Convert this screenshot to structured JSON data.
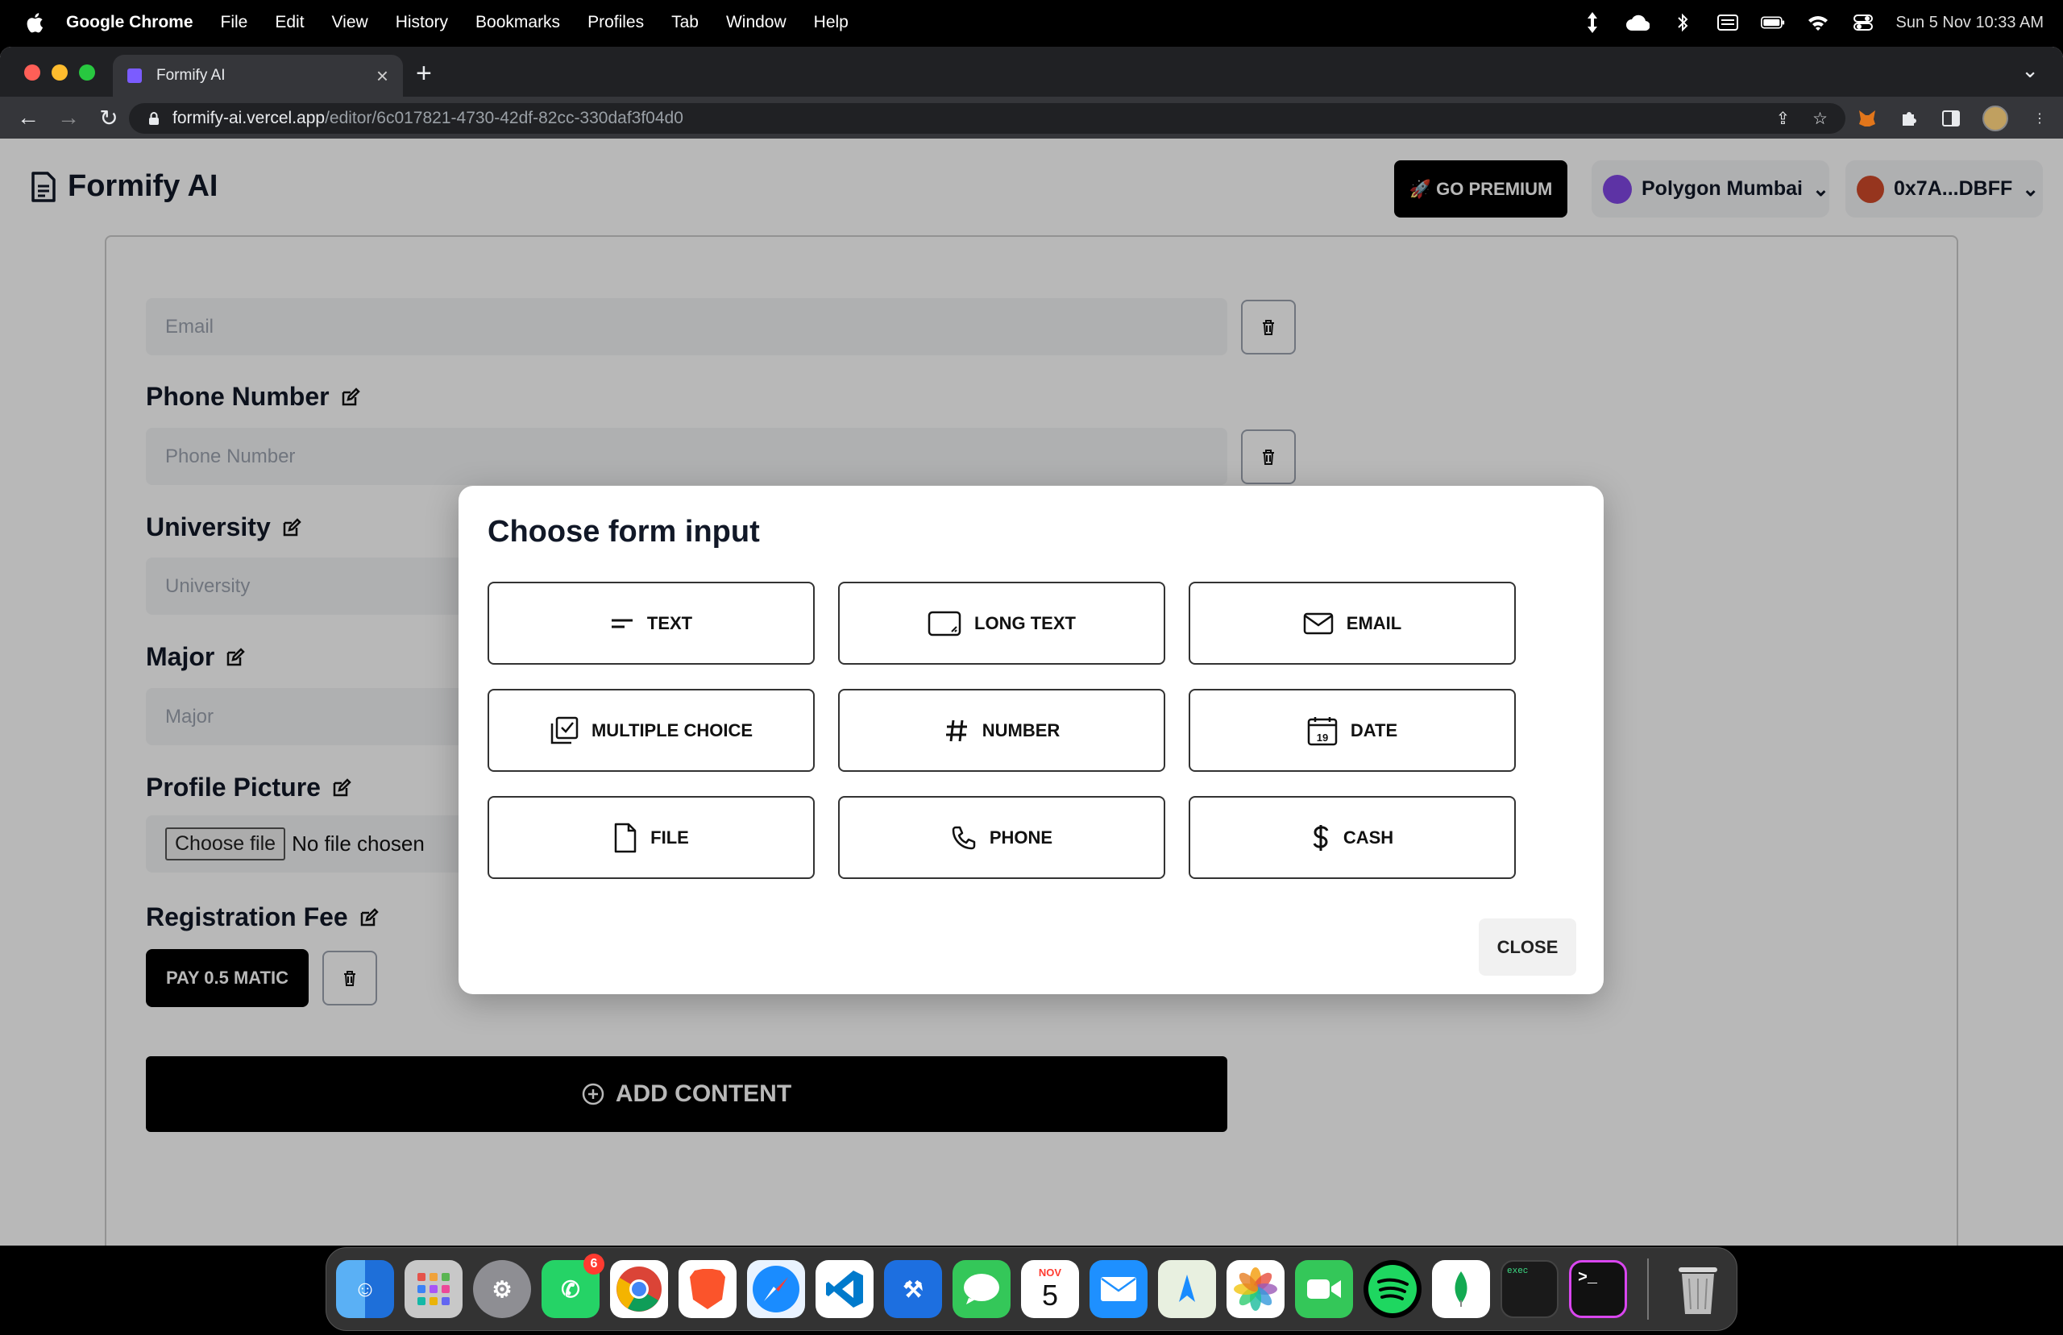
{
  "menubar": {
    "app": "Google Chrome",
    "items": [
      "File",
      "Edit",
      "View",
      "History",
      "Bookmarks",
      "Profiles",
      "Tab",
      "Window",
      "Help"
    ],
    "clock": "Sun 5 Nov  10:33 AM"
  },
  "browser": {
    "tab_title": "Formify AI",
    "url_host": "formify-ai.vercel.app",
    "url_path": "/editor/6c017821-4730-42df-82cc-330daf3f04d0"
  },
  "header": {
    "logo": "Formify AI",
    "premium": "🚀 GO PREMIUM",
    "network": "Polygon Mumbai",
    "account": "0x7A...DBFF"
  },
  "form": {
    "email_placeholder": "Email",
    "phone_label": "Phone Number",
    "phone_placeholder": "Phone Number",
    "university_label": "University",
    "university_placeholder": "University",
    "major_label": "Major",
    "major_placeholder": "Major",
    "profile_label": "Profile Picture",
    "file_button": "Choose file",
    "file_status": "No file chosen",
    "fee_label": "Registration Fee",
    "pay_button": "PAY 0.5 MATIC",
    "add_content": "ADD CONTENT"
  },
  "modal": {
    "title": "Choose form input",
    "options": [
      {
        "label": "TEXT",
        "icon": "text-lines-icon"
      },
      {
        "label": "LONG TEXT",
        "icon": "textarea-icon"
      },
      {
        "label": "EMAIL",
        "icon": "envelope-icon"
      },
      {
        "label": "MULTIPLE CHOICE",
        "icon": "checkbox-multiple-icon"
      },
      {
        "label": "NUMBER",
        "icon": "hash-icon"
      },
      {
        "label": "DATE",
        "icon": "calendar-icon"
      },
      {
        "label": "FILE",
        "icon": "file-icon"
      },
      {
        "label": "PHONE",
        "icon": "phone-icon"
      },
      {
        "label": "CASH",
        "icon": "dollar-icon"
      }
    ],
    "close": "CLOSE"
  },
  "dock": {
    "calendar_month": "NOV",
    "calendar_day": "5",
    "whatsapp_badge": "6",
    "terminal_label": "exec"
  }
}
